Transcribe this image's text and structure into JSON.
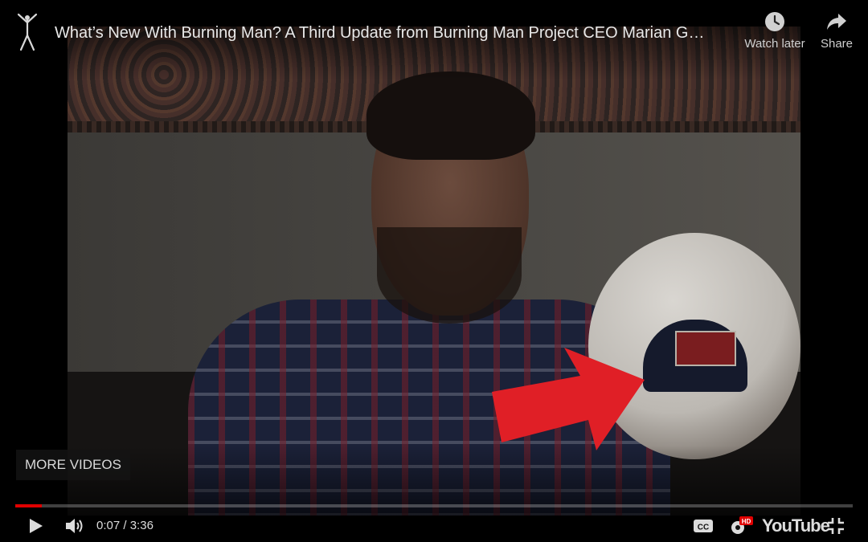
{
  "video": {
    "title": "What’s New With Burning Man? A Third Update from Burning Man Project CEO Marian G…",
    "current_time": "0:07",
    "duration": "3:36",
    "progress_fraction": 0.032
  },
  "top_actions": {
    "watch_later_label": "Watch later",
    "share_label": "Share"
  },
  "overlay": {
    "more_videos_label": "MORE VIDEOS"
  },
  "brand": {
    "youtube_label": "YouTube",
    "accent": "#e00000"
  },
  "icons": {
    "play": "play-icon",
    "volume": "volume-icon",
    "captions": "captions-icon",
    "settings": "settings-icon",
    "hd_badge": "HD",
    "exit_fullscreen": "exit-fullscreen-icon",
    "watch_later": "clock-icon",
    "share": "share-arrow-icon",
    "channel_logo": "burning-man-logo"
  }
}
